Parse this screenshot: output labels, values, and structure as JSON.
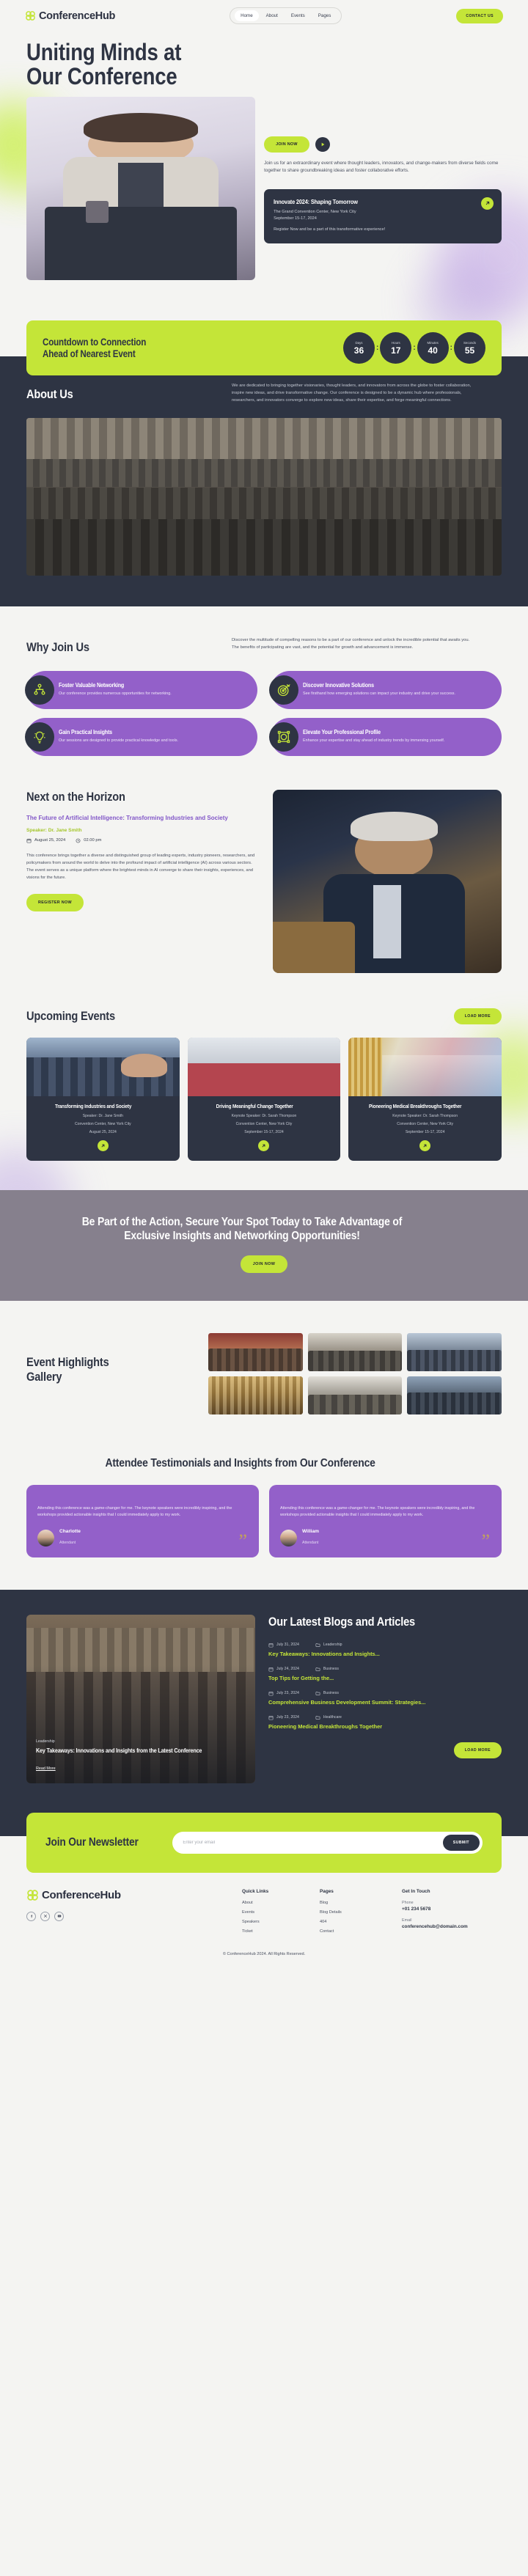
{
  "brand": {
    "name": "ConferenceHub",
    "logo_icon": "atom-cluster-icon"
  },
  "nav": {
    "items": [
      {
        "label": "Home",
        "active": true
      },
      {
        "label": "About",
        "active": false
      },
      {
        "label": "Events",
        "active": false
      },
      {
        "label": "Pages",
        "active": false
      }
    ],
    "cta_label": "CONTACT US"
  },
  "hero": {
    "title_line1": "Uniting Minds at",
    "title_line2": "Our Conference",
    "join_label": "JOIN NOW",
    "play_icon": "play-icon",
    "description": "Join us for an extraordinary event where thought leaders, innovators, and change-makers from diverse fields come together to share groundbreaking ideas and foster collaborative efforts.",
    "event_card": {
      "title": "Innovate 2024: Shaping Tomorrow",
      "venue": "The Grand Convention Center, New York City",
      "dates": "September 15-17, 2024",
      "note": "Register Now and be a part of this transformative experience!",
      "arrow_icon": "arrow-up-right-icon"
    }
  },
  "countdown": {
    "title_line1": "Countdown to Connection",
    "title_line2": "Ahead of Nearest Event",
    "units": [
      {
        "label": "Days",
        "value": "36"
      },
      {
        "label": "Hours",
        "value": "17"
      },
      {
        "label": "Minutes",
        "value": "40"
      },
      {
        "label": "Seconds",
        "value": "55"
      }
    ],
    "separator": ":"
  },
  "about": {
    "heading": "About Us",
    "body": "We are dedicated to bringing together visionaries, thought leaders, and innovators from across the globe to foster collaboration, inspire new ideas, and drive transformative change. Our conference is designed to be a dynamic hub where professionals, researchers, and innovators converge to explore new ideas, share their expertise, and forge meaningful connections."
  },
  "why_join": {
    "heading": "Why Join Us",
    "intro": "Discover the multitude of compelling reasons to be a part of our conference and unlock the incredible potential that awaits you. The benefits of participating are vast, and the potential for growth and advancement is immense.",
    "features": [
      {
        "icon": "network-people-icon",
        "title": "Foster Valuable Networking",
        "text": "Our conference provides numerous opportunities for networking."
      },
      {
        "icon": "target-dart-icon",
        "title": "Discover Innovative Solutions",
        "text": "See firsthand how emerging solutions can impact your industry and drive your success."
      },
      {
        "icon": "lightbulb-icon",
        "title": "Gain Practical Insights",
        "text": "Our sessions are designed to provide practical knowledge and tools."
      },
      {
        "icon": "profile-network-icon",
        "title": "Elevate Your Professional Profile",
        "text": "Enhance your expertise and stay ahead of industry trends by immersing yourself."
      }
    ]
  },
  "horizon": {
    "heading": "Next on the Horizon",
    "subtitle": "The Future of Artificial Intelligence: Transforming Industries and Society",
    "speaker": "Speaker: Dr. Jane Smith",
    "date": "August 25, 2024",
    "date_icon": "calendar-icon",
    "time": "02.00 pm",
    "time_icon": "clock-icon",
    "body": "This conference brings together a diverse and distinguished group of leading experts, industry pioneers, researchers, and policymakers from around the world to delve into the profound impact of artificial intelligence (AI) across various sectors. The event serves as a unique platform where the brightest minds in AI converge to share their insights, experiences, and visions for the future.",
    "button_label": "REGISTER NOW"
  },
  "upcoming": {
    "heading": "Upcoming Events",
    "load_more_label": "LOAD MORE",
    "events": [
      {
        "title": "Transforming Industries and Society",
        "speaker": "Speaker: Dr. Jane Smith",
        "venue": "Convention Center, New York City",
        "date": "August 25, 2024",
        "arrow_icon": "arrow-up-right-icon"
      },
      {
        "title": "Driving Meaningful Change Together",
        "speaker": "Keynote Speaker: Dr. Sarah Thompson",
        "venue": "Convention Center, New York City",
        "date": "September 15-17, 2024",
        "arrow_icon": "arrow-up-right-icon"
      },
      {
        "title": "Pioneering Medical Breakthroughs Together",
        "speaker": "Keynote Speaker: Dr. Sarah Thompson",
        "venue": "Convention Center, New York City",
        "date": "September 15-17, 2024",
        "arrow_icon": "arrow-up-right-icon"
      }
    ]
  },
  "cta_band": {
    "headline_line1": "Be Part of the Action, Secure Your Spot Today to Take Advantage of",
    "headline_line2": "Exclusive Insights and Networking Opportunities!",
    "button_label": "JOIN NOW"
  },
  "gallery": {
    "heading_line1": "Event Highlights",
    "heading_line2": "Gallery",
    "tiles": 6
  },
  "testimonials": {
    "heading": "Attendee Testimonials and Insights from Our Conference",
    "quote_icon": "quotation-mark-icon",
    "items": [
      {
        "quote": "Attending this conference was a game-changer for me. The keynote speakers were incredibly inspiring, and the workshops provided actionable insights that I could immediately apply to my work.",
        "name": "Charlotte",
        "role": "Attendant"
      },
      {
        "quote": "Attending this conference was a game-changer for me. The keynote speakers were incredibly inspiring, and the workshops provided actionable insights that I could immediately apply to my work.",
        "name": "William",
        "role": "Attendant"
      }
    ]
  },
  "blogs": {
    "heading": "Our Latest Blogs and Articles",
    "load_more_label": "LOAD MORE",
    "featured": {
      "category": "Leadership",
      "title": "Key Takeaways: Innovations and Insights from the Latest Conference",
      "read_more_label": "Read More"
    },
    "items": [
      {
        "date": "July 31, 2024",
        "category": "Leadership",
        "title": "Key Takeaways: Innovations and Insights..."
      },
      {
        "date": "July 24, 2024",
        "category": "Business",
        "title": "Top Tips for Getting the..."
      },
      {
        "date": "July 23, 2024",
        "category": "Business",
        "title": "Comprehensive Business Development Summit: Strategies..."
      },
      {
        "date": "July 23, 2024",
        "category": "Healthcare",
        "title": "Pioneering Medical Breakthroughs Together"
      }
    ],
    "date_icon": "calendar-icon",
    "category_icon": "folder-icon"
  },
  "newsletter": {
    "heading": "Join Our Newsletter",
    "placeholder": "Enter your email",
    "value": "",
    "submit_label": "SUBMIT"
  },
  "footer": {
    "socials": [
      {
        "icon": "facebook-icon",
        "glyph": "f"
      },
      {
        "icon": "x-twitter-icon",
        "glyph": "X"
      },
      {
        "icon": "youtube-icon",
        "glyph": "▶"
      }
    ],
    "columns": [
      {
        "heading": "Quick Links",
        "links": [
          "About",
          "Events",
          "Speakers",
          "Ticket"
        ]
      },
      {
        "heading": "Pages",
        "links": [
          "Blog",
          "Blog Details",
          "404",
          "Contact"
        ]
      }
    ],
    "touch": {
      "heading": "Get In Touch",
      "phone_label": "Phone",
      "phone_value": "+01 234 5678",
      "email_label": "Email",
      "email_value": "conferencehub@domain.com"
    },
    "copyright": "© ConferenceHub 2024. All Rights Reserved."
  },
  "colors": {
    "accent_green": "#c4e538",
    "purple": "#9360c9",
    "dark": "#2e3443",
    "page_bg": "#f4f4f2"
  }
}
